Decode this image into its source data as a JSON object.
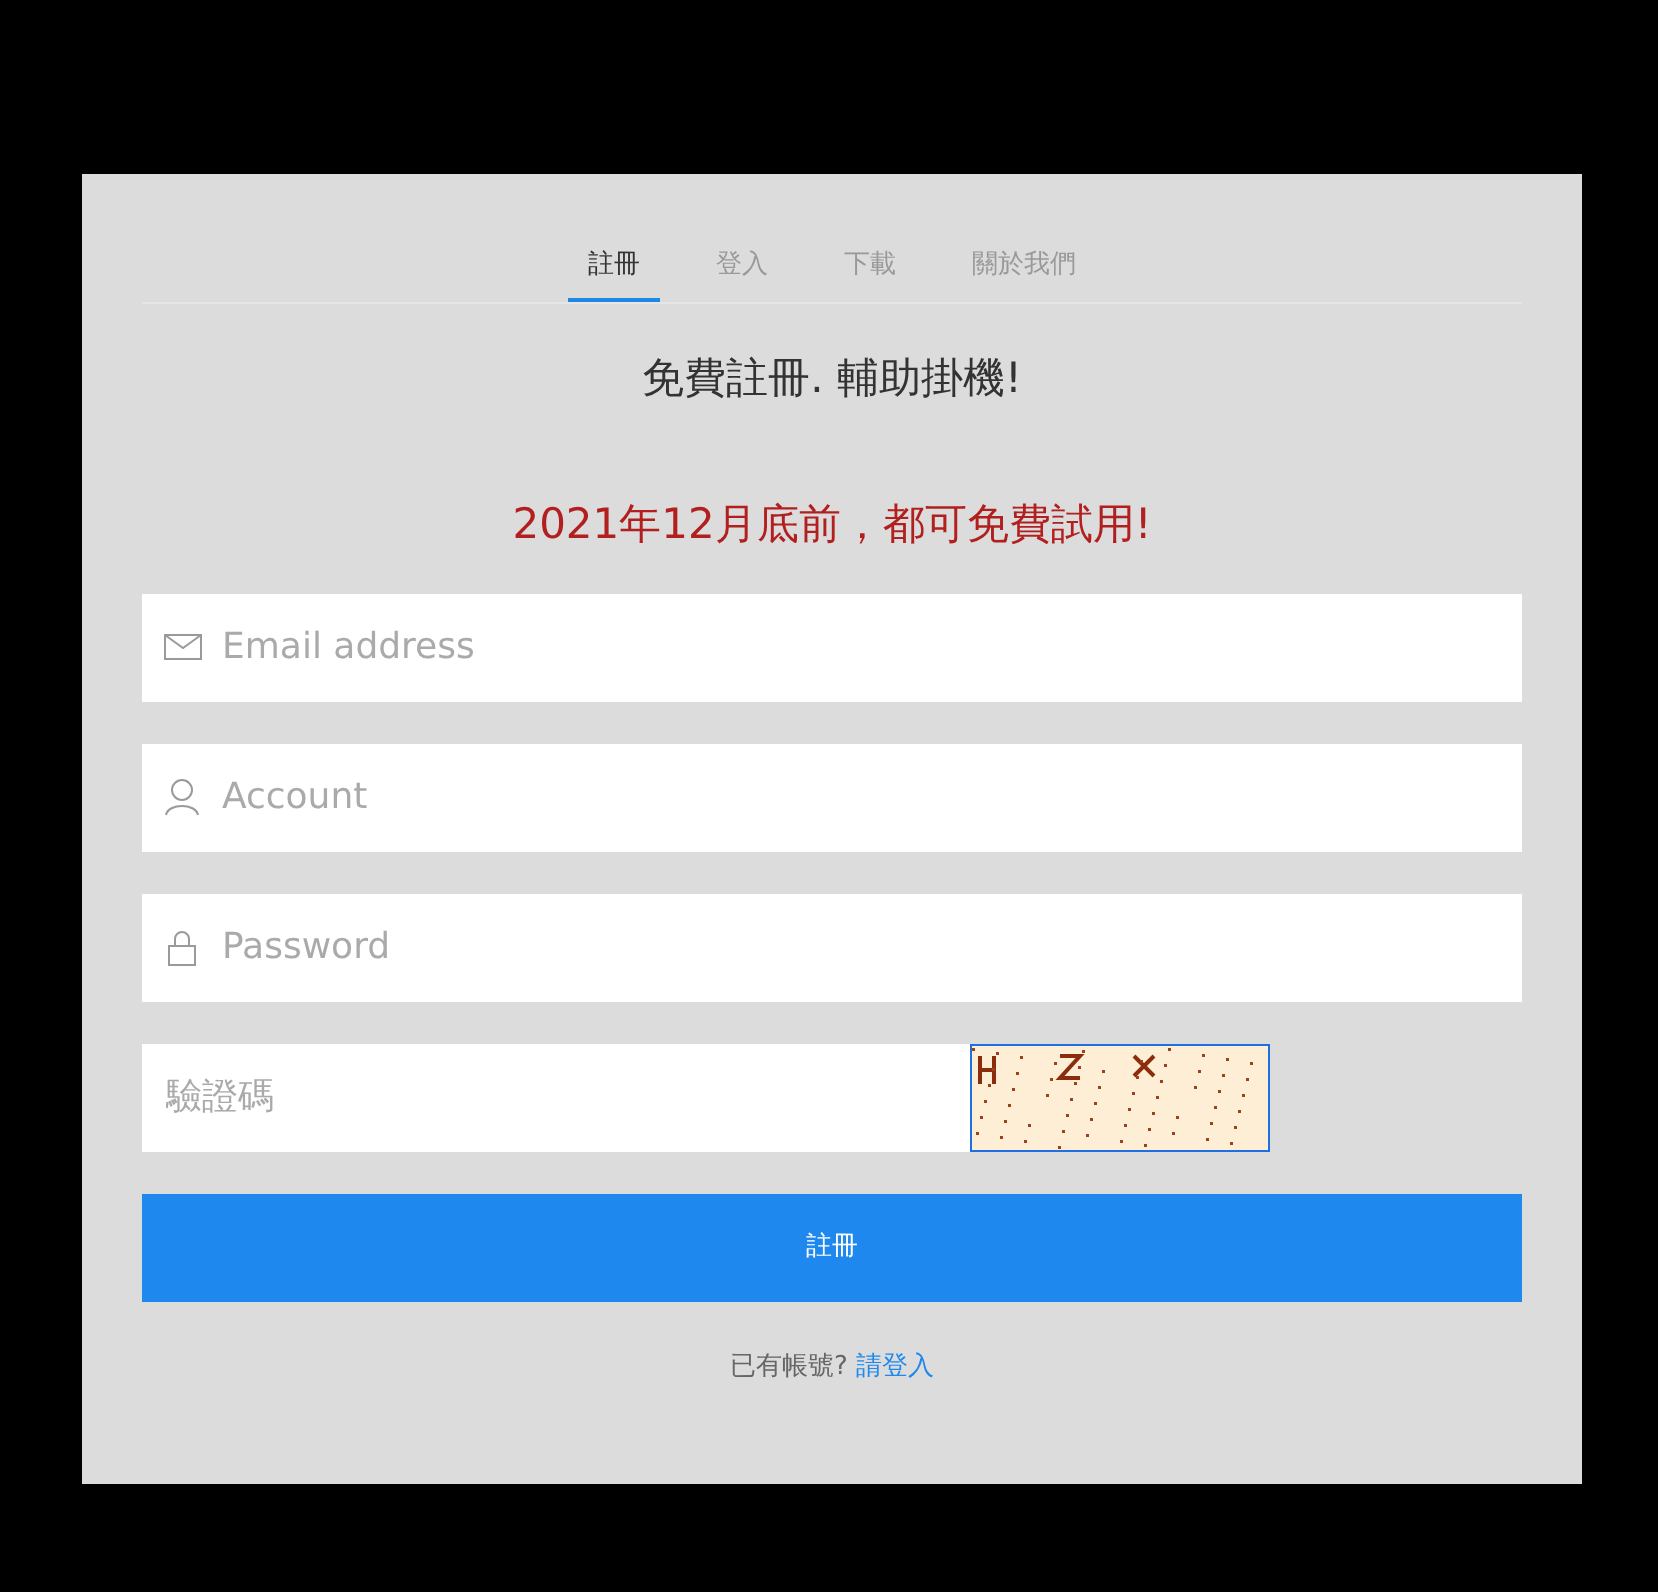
{
  "tabs": [
    {
      "label": "註冊",
      "selected": true
    },
    {
      "label": "登入",
      "selected": false
    },
    {
      "label": "下載",
      "selected": false
    },
    {
      "label": "關於我們",
      "selected": false
    }
  ],
  "heading": "免費註冊. 輔助掛機!",
  "promo": "2021年12月底前，都可免費試用!",
  "fields": [
    {
      "kind": "email",
      "placeholder": "Email address"
    },
    {
      "kind": "account",
      "placeholder": "Account"
    },
    {
      "kind": "password",
      "placeholder": "Password"
    }
  ],
  "captcha": {
    "placeholder": "驗證碼"
  },
  "submit": "註冊",
  "footer": {
    "prompt": "已有帳號?",
    "link": "請登入"
  }
}
